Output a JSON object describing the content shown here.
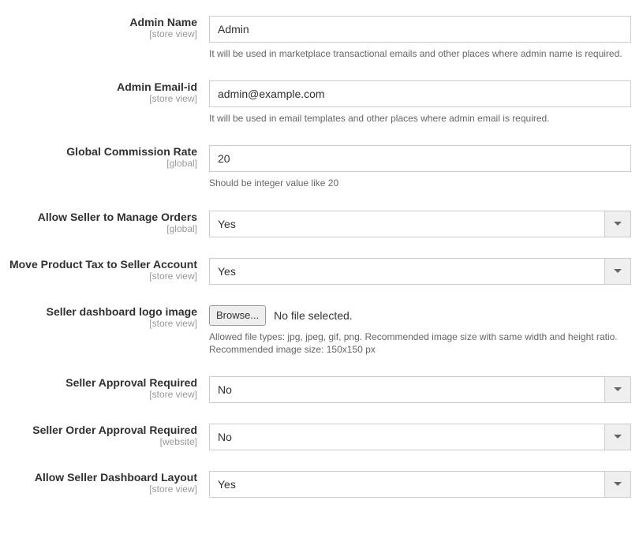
{
  "scopes": {
    "store_view": "store view",
    "global": "global",
    "website": "website"
  },
  "fields": {
    "admin_name": {
      "label": "Admin Name",
      "value": "Admin",
      "help": "It will be used in marketplace transactional emails and other places where admin name is required."
    },
    "admin_email": {
      "label": "Admin Email-id",
      "value": "admin@example.com",
      "help": "It will be used in email templates and other places where admin email is required."
    },
    "global_commission": {
      "label": "Global Commission Rate",
      "value": "20",
      "help": "Should be integer value like 20"
    },
    "allow_manage_orders": {
      "label": "Allow Seller to Manage Orders",
      "value": "Yes"
    },
    "move_product_tax": {
      "label": "Move Product Tax to Seller Account",
      "value": "Yes"
    },
    "seller_logo": {
      "label": "Seller dashboard logo image",
      "browse_label": "Browse...",
      "status": "No file selected.",
      "help": "Allowed file types: jpg, jpeg, gif, png. Recommended image size with same width and height ratio. Recommended image size: 150x150 px"
    },
    "seller_approval": {
      "label": "Seller Approval Required",
      "value": "No"
    },
    "seller_order_approval": {
      "label": "Seller Order Approval Required",
      "value": "No"
    },
    "allow_dashboard_layout": {
      "label": "Allow Seller Dashboard Layout",
      "value": "Yes"
    }
  }
}
